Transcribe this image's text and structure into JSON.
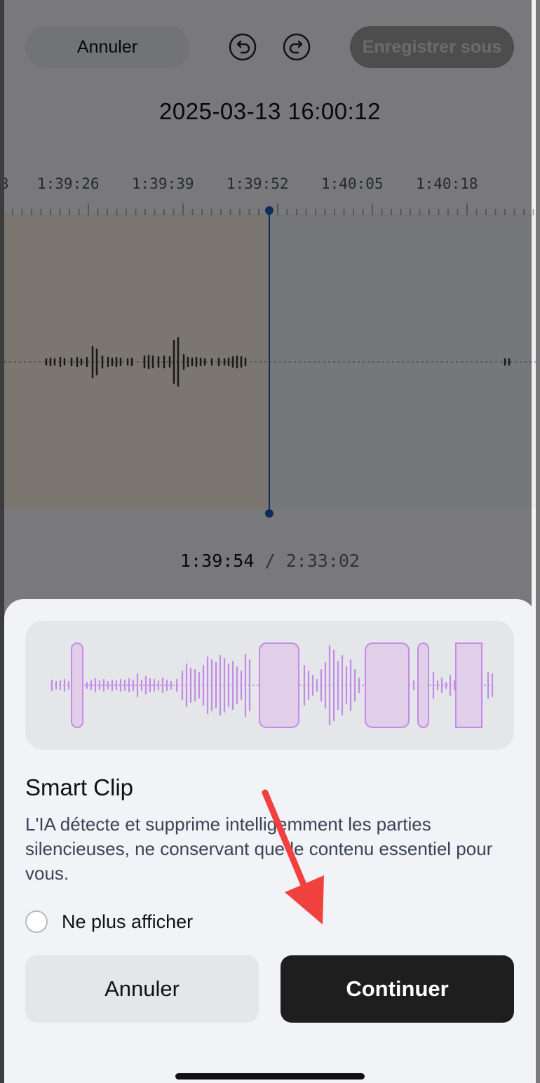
{
  "topbar": {
    "cancel_label": "Annuler",
    "undo_icon": "undo-icon",
    "redo_icon": "redo-icon",
    "save_label": "Enregistrer sous"
  },
  "recording": {
    "title": "2025-03-13 16:00:12"
  },
  "timeline": {
    "ruler_labels": [
      "3",
      "1:39:26",
      "1:39:39",
      "1:39:52",
      "1:40:05",
      "1:40:18"
    ],
    "current_time": "1:39:54",
    "separator": "/",
    "total_time": "2:33:02"
  },
  "sheet": {
    "title": "Smart Clip",
    "description": "L'IA détecte et supprime intelligemment les parties silencieuses, ne conservant que le contenu essentiel pour vous.",
    "checkbox_label": "Ne plus afficher",
    "cancel_label": "Annuler",
    "continue_label": "Continuer"
  },
  "colors": {
    "accent_purple": "#c48be6",
    "playhead_blue": "#1f5bb8",
    "annotation_red": "#f0413f"
  }
}
